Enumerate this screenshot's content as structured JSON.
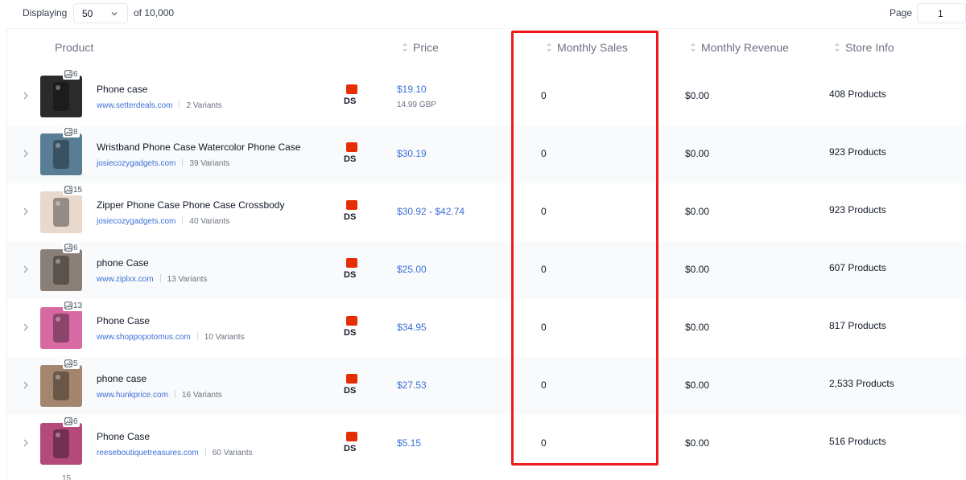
{
  "toolbar": {
    "displaying_label": "Displaying",
    "page_size": "50",
    "of_total": "of 10,000",
    "page_label": "Page",
    "page_value": "1"
  },
  "columns": {
    "product": "Product",
    "price": "Price",
    "monthly_sales": "Monthly Sales",
    "monthly_revenue": "Monthly Revenue",
    "store_info": "Store Info"
  },
  "supplier_badge": "DS",
  "rows": [
    {
      "image_count": "6",
      "name": "Phone case",
      "store": "www.setterdeals.com",
      "variants": "2 Variants",
      "price": "$19.10",
      "price_sub": "14.99 GBP",
      "sales": "0",
      "revenue": "$0.00",
      "store_info": "408 Products",
      "thumb_color": "#2b2b2b"
    },
    {
      "image_count": "8",
      "name": "Wristband Phone Case Watercolor Phone Case",
      "store": "josiecozygadgets.com",
      "variants": "39 Variants",
      "price": "$30.19",
      "price_sub": "",
      "sales": "0",
      "revenue": "$0.00",
      "store_info": "923 Products",
      "thumb_color": "#5a7d96"
    },
    {
      "image_count": "15",
      "name": "Zipper Phone Case Phone Case Crossbody",
      "store": "josiecozygadgets.com",
      "variants": "40 Variants",
      "price": "$30.92 - $42.74",
      "price_sub": "",
      "sales": "0",
      "revenue": "$0.00",
      "store_info": "923 Products",
      "thumb_color": "#e9d8cc"
    },
    {
      "image_count": "6",
      "name": "phone Case",
      "store": "www.ziplxx.com",
      "variants": "13 Variants",
      "price": "$25.00",
      "price_sub": "",
      "sales": "0",
      "revenue": "$0.00",
      "store_info": "607 Products",
      "thumb_color": "#8a7f76"
    },
    {
      "image_count": "13",
      "name": "Phone Case",
      "store": "www.shoppopotomus.com",
      "variants": "10 Variants",
      "price": "$34.95",
      "price_sub": "",
      "sales": "0",
      "revenue": "$0.00",
      "store_info": "817 Products",
      "thumb_color": "#d86aa3"
    },
    {
      "image_count": "5",
      "name": "phone case",
      "store": "www.hunkprice.com",
      "variants": "16 Variants",
      "price": "$27.53",
      "price_sub": "",
      "sales": "0",
      "revenue": "$0.00",
      "store_info": "2,533 Products",
      "thumb_color": "#a4866e"
    },
    {
      "image_count": "6",
      "name": "Phone Case",
      "store": "reeseboutiquetreasures.com",
      "variants": "60 Variants",
      "price": "$5.15",
      "price_sub": "",
      "sales": "0",
      "revenue": "$0.00",
      "store_info": "516 Products",
      "thumb_color": "#b34a7b"
    }
  ],
  "partial_row": {
    "image_count": "15"
  },
  "colors": {
    "link": "#3b6fd8",
    "highlight": "#ef1b1b",
    "aliexpress": "#e62e04"
  }
}
